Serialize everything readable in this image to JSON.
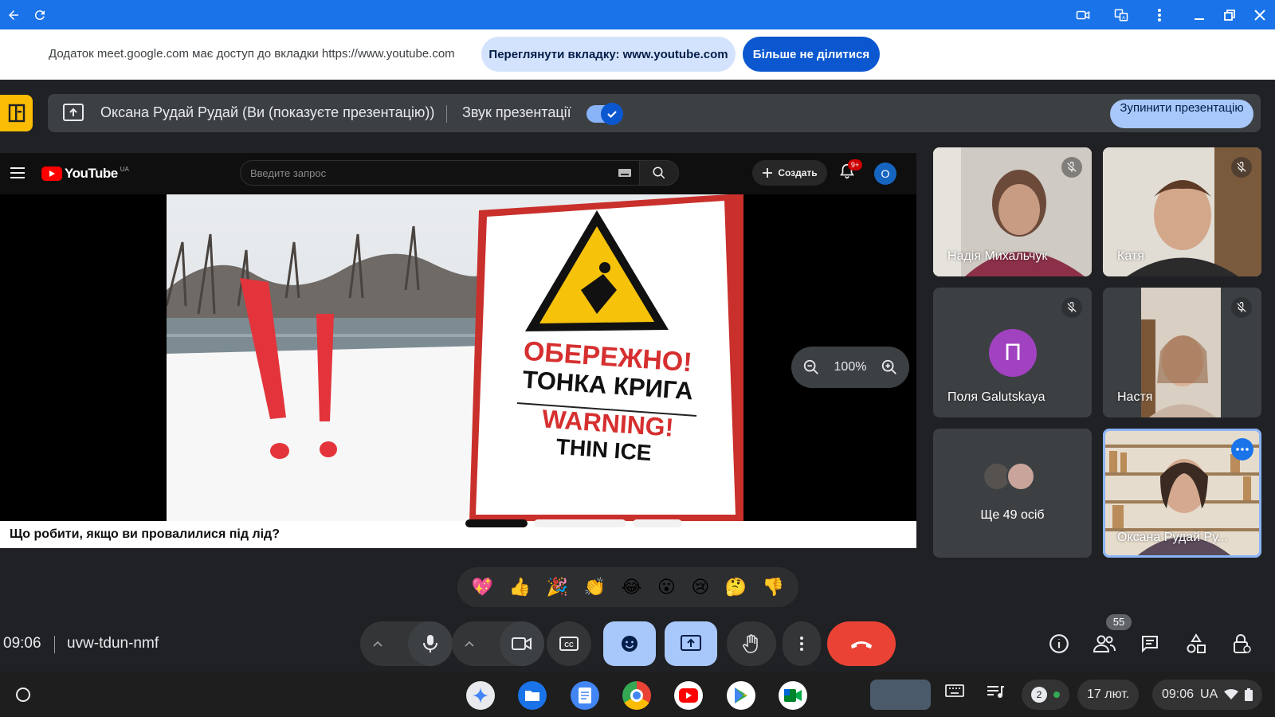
{
  "infobar": {
    "message": "Додаток meet.google.com має доступ до вкладки https://www.youtube.com",
    "view_tab_label": "Переглянути вкладку: www.youtube.com",
    "stop_sharing_label": "Більше не ділитися"
  },
  "presentation": {
    "presenter_label": "Оксана Рудай Рудай (Ви (показуєте презентацію))",
    "audio_label": "Звук презентації",
    "audio_enabled": true,
    "stop_label": "Зупинити презентацію"
  },
  "youtube": {
    "logo_text": "YouTube",
    "region": "UA",
    "search_placeholder": "Введите запрос",
    "create_label": "Создать",
    "notifications_badge": "9+",
    "avatar_letter": "О",
    "video_title": "Що робити, якщо ви провалилися під лід?",
    "sign_lines": [
      "ОБЕРЕЖНО!",
      "ТОНКА КРИГА",
      "WARNING!",
      "THIN ICE"
    ],
    "zoom_level": "100%"
  },
  "participants": [
    {
      "name": "Надія Михальчук",
      "muted": true
    },
    {
      "name": "Катя",
      "muted": true
    },
    {
      "name": "Поля Galutskaya",
      "initial": "П",
      "avatar_color": "#a142c0",
      "muted": true
    },
    {
      "name": "Настя",
      "muted": true
    },
    {
      "name": "Оксана Рудай Ру...",
      "highlighted": true
    }
  ],
  "others_label": "Ще 49 осіб",
  "reactions": [
    "💖",
    "👍",
    "🎉",
    "👏",
    "😂",
    "😮",
    "😢",
    "🤔",
    "👎"
  ],
  "meeting": {
    "time": "09:06",
    "code": "uvw-tdun-nmf",
    "people_count": "55"
  },
  "shelf": {
    "notification_count": "2",
    "date": "17 лют.",
    "time": "09:06",
    "locale": "UA"
  },
  "colors": {
    "titlebar": "#1a73e8",
    "accent": "#0b57d0",
    "end_call": "#ea4335",
    "presenting_tab": "#fbbc04"
  }
}
